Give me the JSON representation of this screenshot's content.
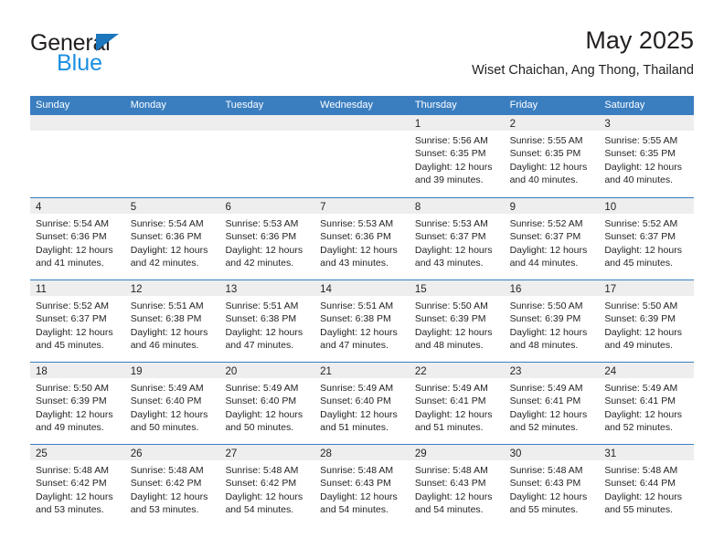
{
  "brand": {
    "word_one": "General",
    "word_two": "Blue",
    "triangle_color": "#1b76bc",
    "blue_color": "#1b8fe0"
  },
  "header": {
    "title": "May 2025",
    "subtitle": "Wiset Chaichan, Ang Thong, Thailand"
  },
  "colors": {
    "header_blue": "#3a7ec0",
    "daynum_band": "#eeeeee",
    "text": "#231f20"
  },
  "weekday_headers": [
    "Sunday",
    "Monday",
    "Tuesday",
    "Wednesday",
    "Thursday",
    "Friday",
    "Saturday"
  ],
  "weeks": [
    [
      {
        "day": "",
        "lines": []
      },
      {
        "day": "",
        "lines": []
      },
      {
        "day": "",
        "lines": []
      },
      {
        "day": "",
        "lines": []
      },
      {
        "day": "1",
        "lines": [
          "Sunrise: 5:56 AM",
          "Sunset: 6:35 PM",
          "Daylight: 12 hours",
          "and 39 minutes."
        ]
      },
      {
        "day": "2",
        "lines": [
          "Sunrise: 5:55 AM",
          "Sunset: 6:35 PM",
          "Daylight: 12 hours",
          "and 40 minutes."
        ]
      },
      {
        "day": "3",
        "lines": [
          "Sunrise: 5:55 AM",
          "Sunset: 6:35 PM",
          "Daylight: 12 hours",
          "and 40 minutes."
        ]
      }
    ],
    [
      {
        "day": "4",
        "lines": [
          "Sunrise: 5:54 AM",
          "Sunset: 6:36 PM",
          "Daylight: 12 hours",
          "and 41 minutes."
        ]
      },
      {
        "day": "5",
        "lines": [
          "Sunrise: 5:54 AM",
          "Sunset: 6:36 PM",
          "Daylight: 12 hours",
          "and 42 minutes."
        ]
      },
      {
        "day": "6",
        "lines": [
          "Sunrise: 5:53 AM",
          "Sunset: 6:36 PM",
          "Daylight: 12 hours",
          "and 42 minutes."
        ]
      },
      {
        "day": "7",
        "lines": [
          "Sunrise: 5:53 AM",
          "Sunset: 6:36 PM",
          "Daylight: 12 hours",
          "and 43 minutes."
        ]
      },
      {
        "day": "8",
        "lines": [
          "Sunrise: 5:53 AM",
          "Sunset: 6:37 PM",
          "Daylight: 12 hours",
          "and 43 minutes."
        ]
      },
      {
        "day": "9",
        "lines": [
          "Sunrise: 5:52 AM",
          "Sunset: 6:37 PM",
          "Daylight: 12 hours",
          "and 44 minutes."
        ]
      },
      {
        "day": "10",
        "lines": [
          "Sunrise: 5:52 AM",
          "Sunset: 6:37 PM",
          "Daylight: 12 hours",
          "and 45 minutes."
        ]
      }
    ],
    [
      {
        "day": "11",
        "lines": [
          "Sunrise: 5:52 AM",
          "Sunset: 6:37 PM",
          "Daylight: 12 hours",
          "and 45 minutes."
        ]
      },
      {
        "day": "12",
        "lines": [
          "Sunrise: 5:51 AM",
          "Sunset: 6:38 PM",
          "Daylight: 12 hours",
          "and 46 minutes."
        ]
      },
      {
        "day": "13",
        "lines": [
          "Sunrise: 5:51 AM",
          "Sunset: 6:38 PM",
          "Daylight: 12 hours",
          "and 47 minutes."
        ]
      },
      {
        "day": "14",
        "lines": [
          "Sunrise: 5:51 AM",
          "Sunset: 6:38 PM",
          "Daylight: 12 hours",
          "and 47 minutes."
        ]
      },
      {
        "day": "15",
        "lines": [
          "Sunrise: 5:50 AM",
          "Sunset: 6:39 PM",
          "Daylight: 12 hours",
          "and 48 minutes."
        ]
      },
      {
        "day": "16",
        "lines": [
          "Sunrise: 5:50 AM",
          "Sunset: 6:39 PM",
          "Daylight: 12 hours",
          "and 48 minutes."
        ]
      },
      {
        "day": "17",
        "lines": [
          "Sunrise: 5:50 AM",
          "Sunset: 6:39 PM",
          "Daylight: 12 hours",
          "and 49 minutes."
        ]
      }
    ],
    [
      {
        "day": "18",
        "lines": [
          "Sunrise: 5:50 AM",
          "Sunset: 6:39 PM",
          "Daylight: 12 hours",
          "and 49 minutes."
        ]
      },
      {
        "day": "19",
        "lines": [
          "Sunrise: 5:49 AM",
          "Sunset: 6:40 PM",
          "Daylight: 12 hours",
          "and 50 minutes."
        ]
      },
      {
        "day": "20",
        "lines": [
          "Sunrise: 5:49 AM",
          "Sunset: 6:40 PM",
          "Daylight: 12 hours",
          "and 50 minutes."
        ]
      },
      {
        "day": "21",
        "lines": [
          "Sunrise: 5:49 AM",
          "Sunset: 6:40 PM",
          "Daylight: 12 hours",
          "and 51 minutes."
        ]
      },
      {
        "day": "22",
        "lines": [
          "Sunrise: 5:49 AM",
          "Sunset: 6:41 PM",
          "Daylight: 12 hours",
          "and 51 minutes."
        ]
      },
      {
        "day": "23",
        "lines": [
          "Sunrise: 5:49 AM",
          "Sunset: 6:41 PM",
          "Daylight: 12 hours",
          "and 52 minutes."
        ]
      },
      {
        "day": "24",
        "lines": [
          "Sunrise: 5:49 AM",
          "Sunset: 6:41 PM",
          "Daylight: 12 hours",
          "and 52 minutes."
        ]
      }
    ],
    [
      {
        "day": "25",
        "lines": [
          "Sunrise: 5:48 AM",
          "Sunset: 6:42 PM",
          "Daylight: 12 hours",
          "and 53 minutes."
        ]
      },
      {
        "day": "26",
        "lines": [
          "Sunrise: 5:48 AM",
          "Sunset: 6:42 PM",
          "Daylight: 12 hours",
          "and 53 minutes."
        ]
      },
      {
        "day": "27",
        "lines": [
          "Sunrise: 5:48 AM",
          "Sunset: 6:42 PM",
          "Daylight: 12 hours",
          "and 54 minutes."
        ]
      },
      {
        "day": "28",
        "lines": [
          "Sunrise: 5:48 AM",
          "Sunset: 6:43 PM",
          "Daylight: 12 hours",
          "and 54 minutes."
        ]
      },
      {
        "day": "29",
        "lines": [
          "Sunrise: 5:48 AM",
          "Sunset: 6:43 PM",
          "Daylight: 12 hours",
          "and 54 minutes."
        ]
      },
      {
        "day": "30",
        "lines": [
          "Sunrise: 5:48 AM",
          "Sunset: 6:43 PM",
          "Daylight: 12 hours",
          "and 55 minutes."
        ]
      },
      {
        "day": "31",
        "lines": [
          "Sunrise: 5:48 AM",
          "Sunset: 6:44 PM",
          "Daylight: 12 hours",
          "and 55 minutes."
        ]
      }
    ]
  ]
}
